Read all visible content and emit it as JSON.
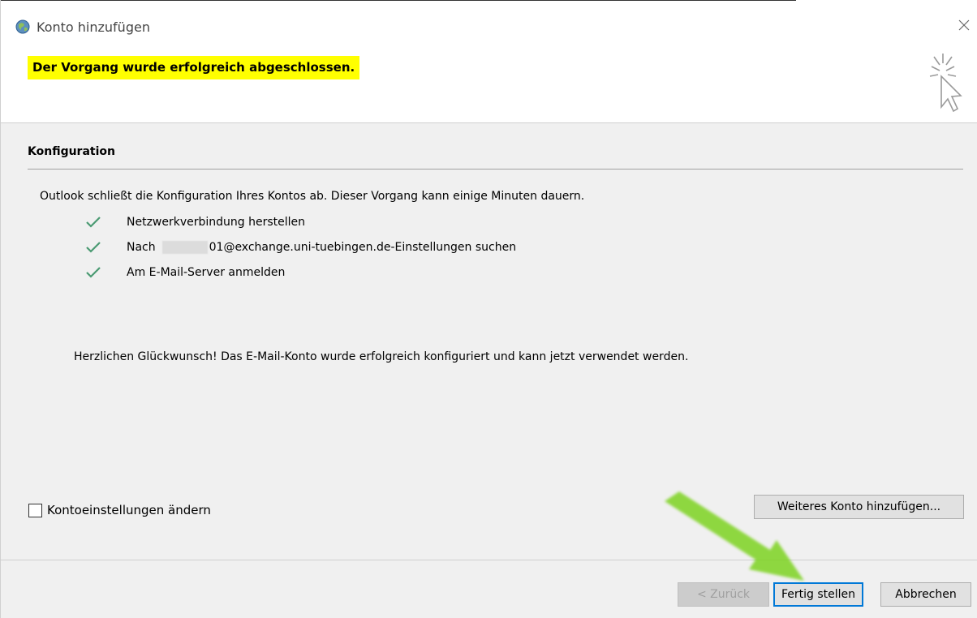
{
  "window": {
    "title": "Konto hinzufügen"
  },
  "header": {
    "status": "Der Vorgang wurde erfolgreich abgeschlossen."
  },
  "configuration": {
    "section_title": "Konfiguration",
    "intro": "Outlook schließt die Konfiguration Ihres Kontos ab. Dieser Vorgang kann einige Minuten dauern.",
    "steps": [
      {
        "label": "Netzwerkverbindung herstellen"
      },
      {
        "label_prefix": "Nach",
        "label_suffix": "01@exchange.uni-tuebingen.de-Einstellungen suchen"
      },
      {
        "label": "Am E-Mail-Server anmelden"
      }
    ],
    "congrats": "Herzlichen Glückwunsch! Das E-Mail-Konto wurde erfolgreich konfiguriert und kann jetzt verwendet werden."
  },
  "options": {
    "change_settings_label": "Kontoeinstellungen ändern",
    "change_settings_checked": false,
    "add_account_label": "Weiteres Konto hinzufügen..."
  },
  "footer": {
    "back_label": "< Zurück",
    "finish_label": "Fertig stellen",
    "cancel_label": "Abbrechen"
  },
  "colors": {
    "highlight": "#ffff00",
    "check": "#4a9a72",
    "annotation_arrow": "#7ed321",
    "focus_border": "#0078d7"
  },
  "icons": {
    "app": "outlook-globe-icon",
    "close": "close-icon",
    "cursor": "click-cursor-icon",
    "check": "check-icon"
  }
}
